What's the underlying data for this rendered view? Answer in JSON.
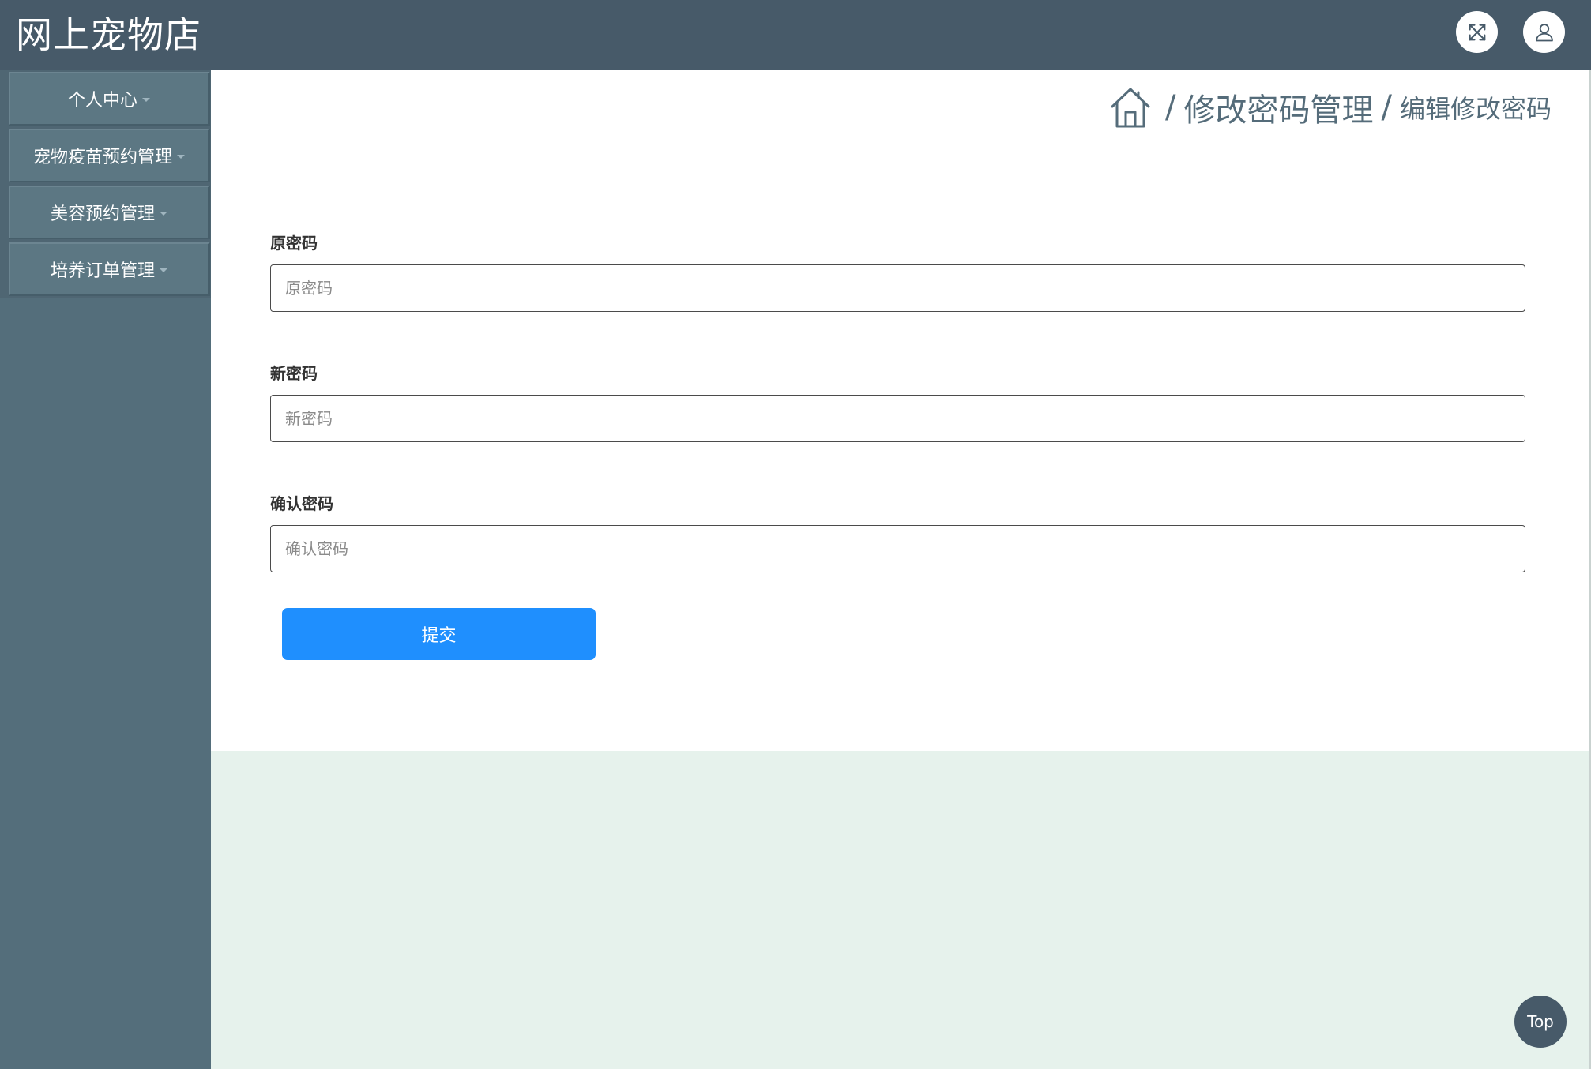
{
  "app": {
    "title": "网上宠物店"
  },
  "header": {
    "fullscreen_icon": "expand-arrows-icon",
    "user_icon": "user-icon"
  },
  "sidebar": {
    "items": [
      {
        "label": "个人中心"
      },
      {
        "label": "宠物疫苗预约管理"
      },
      {
        "label": "美容预约管理"
      },
      {
        "label": "培养订单管理"
      }
    ]
  },
  "breadcrumb": {
    "home_icon": "home-icon",
    "separator": "/",
    "level1": "修改密码管理",
    "level2": "编辑修改密码"
  },
  "form": {
    "old_password": {
      "label": "原密码",
      "placeholder": "原密码"
    },
    "new_password": {
      "label": "新密码",
      "placeholder": "新密码"
    },
    "confirm_password": {
      "label": "确认密码",
      "placeholder": "确认密码"
    },
    "submit_label": "提交"
  },
  "back_to_top": {
    "label": "Top"
  },
  "colors": {
    "header_bg": "#475a69",
    "sidebar_bg": "#546e7b",
    "accent": "#1f8ffe",
    "page_bg": "#e6f2ec"
  }
}
